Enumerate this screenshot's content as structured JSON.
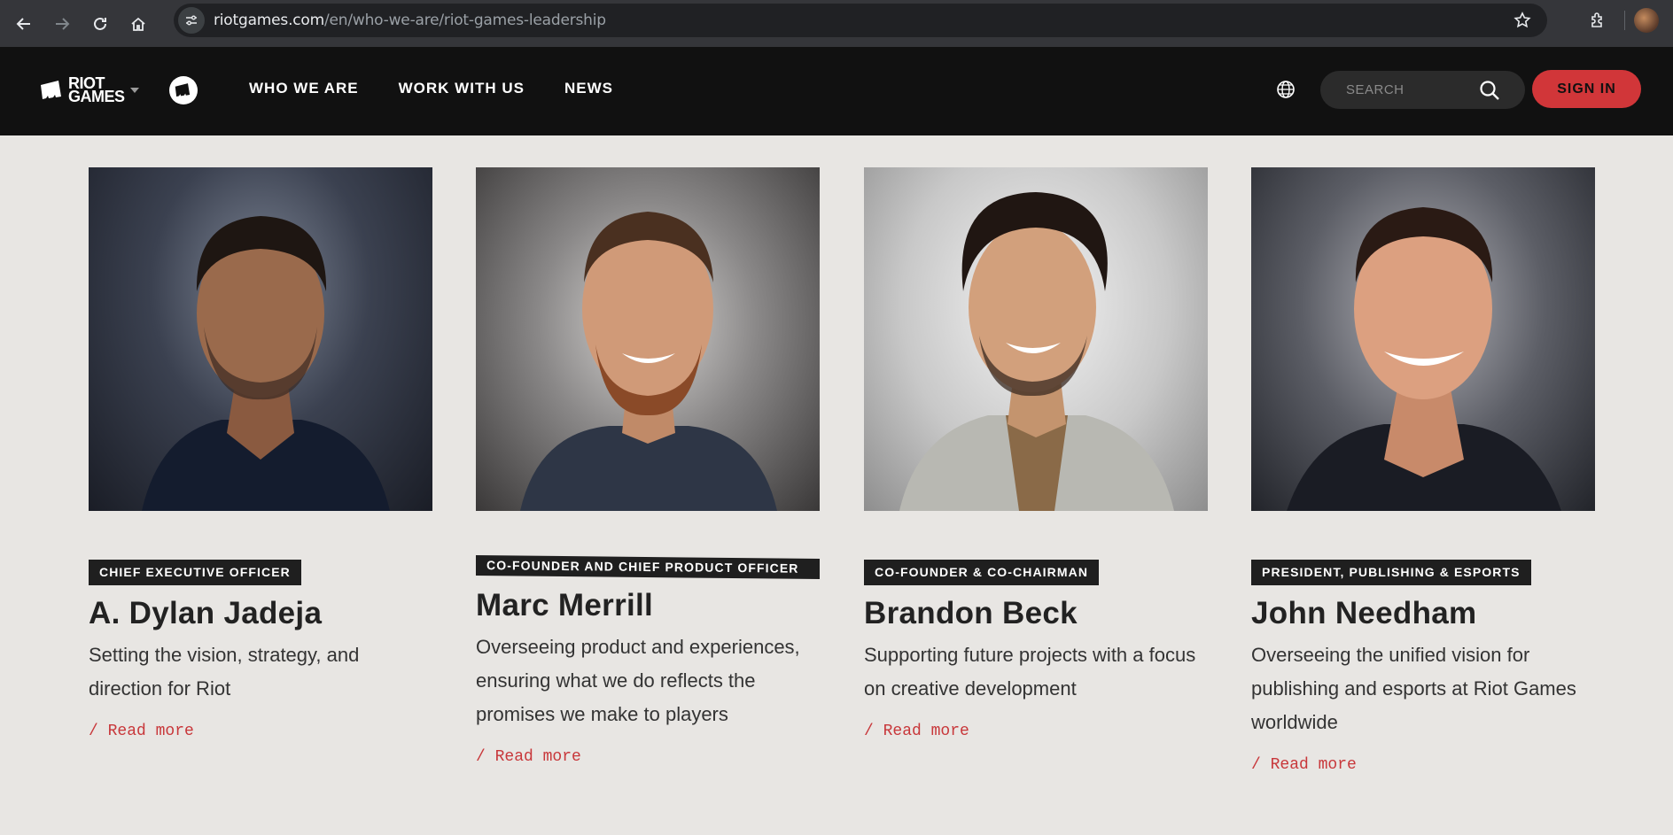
{
  "browser": {
    "url_host": "riotgames.com",
    "url_path": "/en/who-we-are/riot-games-leadership"
  },
  "header": {
    "logo_line1": "RIOT",
    "logo_line2": "GAMES",
    "nav": [
      "WHO WE ARE",
      "WORK WITH US",
      "NEWS"
    ],
    "search_placeholder": "SEARCH",
    "sign_in": "SIGN IN"
  },
  "colors": {
    "accent": "#d13639",
    "header_bg": "#111111",
    "page_bg": "#e8e6e3",
    "link": "#c8373a"
  },
  "leaders": [
    {
      "title": "CHIEF EXECUTIVE OFFICER",
      "name": "A. Dylan Jadeja",
      "description": "Setting the vision, strategy, and direction for Riot",
      "read_more": "/ Read more"
    },
    {
      "title": "CO-FOUNDER AND CHIEF PRODUCT OFFICER",
      "name": "Marc Merrill",
      "description": "Overseeing product and experiences, ensuring what we do reflects the promises we make to players",
      "read_more": "/ Read more"
    },
    {
      "title": "CO-FOUNDER & CO-CHAIRMAN",
      "name": "Brandon Beck",
      "description": "Supporting future projects with a focus on creative development",
      "read_more": "/ Read more"
    },
    {
      "title": "PRESIDENT, PUBLISHING & ESPORTS",
      "name": "John Needham",
      "description": "Overseeing the unified vision for publishing and esports at Riot Games worldwide",
      "read_more": "/ Read more"
    }
  ]
}
